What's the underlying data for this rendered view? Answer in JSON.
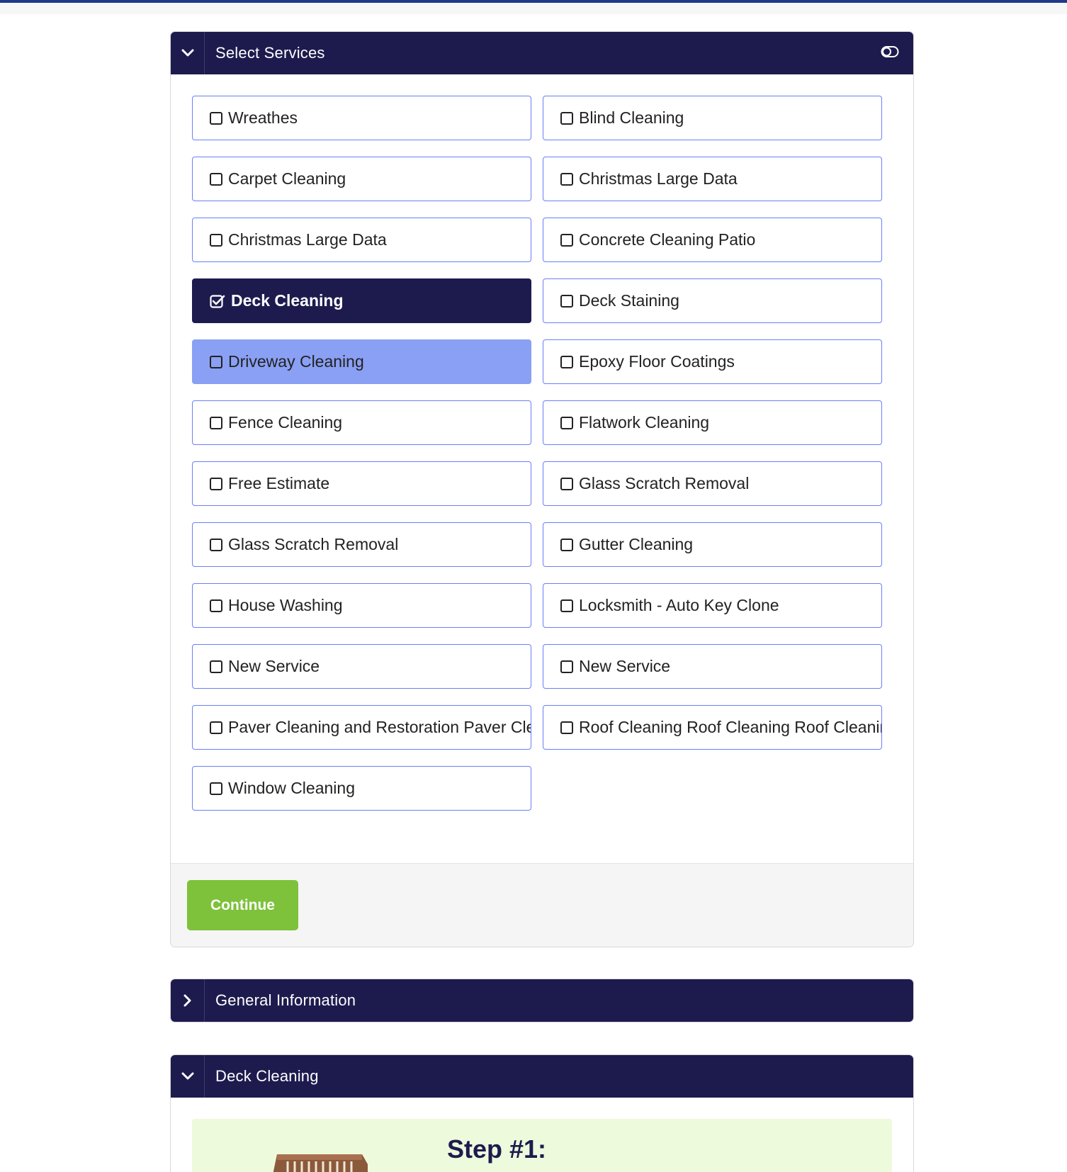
{
  "select_services": {
    "title": "Select Services",
    "services": [
      {
        "label": "Wreathes",
        "state": "unchecked"
      },
      {
        "label": "Blind Cleaning",
        "state": "unchecked"
      },
      {
        "label": "Carpet Cleaning",
        "state": "unchecked"
      },
      {
        "label": "Christmas Large Data",
        "state": "unchecked"
      },
      {
        "label": "Christmas Large Data",
        "state": "unchecked"
      },
      {
        "label": "Concrete Cleaning Patio",
        "state": "unchecked"
      },
      {
        "label": "Deck Cleaning",
        "state": "checked"
      },
      {
        "label": "Deck Staining",
        "state": "unchecked"
      },
      {
        "label": "Driveway Cleaning",
        "state": "hover"
      },
      {
        "label": "Epoxy Floor Coatings",
        "state": "unchecked"
      },
      {
        "label": "Fence Cleaning",
        "state": "unchecked"
      },
      {
        "label": "Flatwork Cleaning",
        "state": "unchecked"
      },
      {
        "label": "Free Estimate",
        "state": "unchecked"
      },
      {
        "label": "Glass Scratch Removal",
        "state": "unchecked"
      },
      {
        "label": "Glass Scratch Removal",
        "state": "unchecked"
      },
      {
        "label": "Gutter Cleaning",
        "state": "unchecked"
      },
      {
        "label": "House Washing",
        "state": "unchecked"
      },
      {
        "label": "Locksmith - Auto Key Clone",
        "state": "unchecked"
      },
      {
        "label": "New Service",
        "state": "unchecked"
      },
      {
        "label": "New Service",
        "state": "unchecked"
      },
      {
        "label": "Paver Cleaning and Restoration Paver Cleaning and Restoration",
        "state": "unchecked"
      },
      {
        "label": "Roof Cleaning Roof Cleaning Roof Cleaning",
        "state": "unchecked"
      },
      {
        "label": "Window Cleaning",
        "state": "unchecked"
      }
    ],
    "continue_label": "Continue"
  },
  "general_information": {
    "title": "General Information"
  },
  "deck_cleaning": {
    "title": "Deck Cleaning",
    "step_title": "Step #1:"
  },
  "colors": {
    "header_bg": "#1d1b4e",
    "selected_bg": "#1d1b4e",
    "hover_bg": "#8aa0f4",
    "option_border": "#6b7ff5",
    "continue_bg": "#7dc23a",
    "step_bg": "#eefadc",
    "top_accent": "#1f3a8a"
  },
  "icons": {
    "expanded_toggle": "chevron-down-icon",
    "collapsed_toggle": "chevron-right-icon",
    "header_action": "toggle-icon",
    "unchecked": "checkbox-empty-icon",
    "checked": "checkbox-checked-icon"
  }
}
